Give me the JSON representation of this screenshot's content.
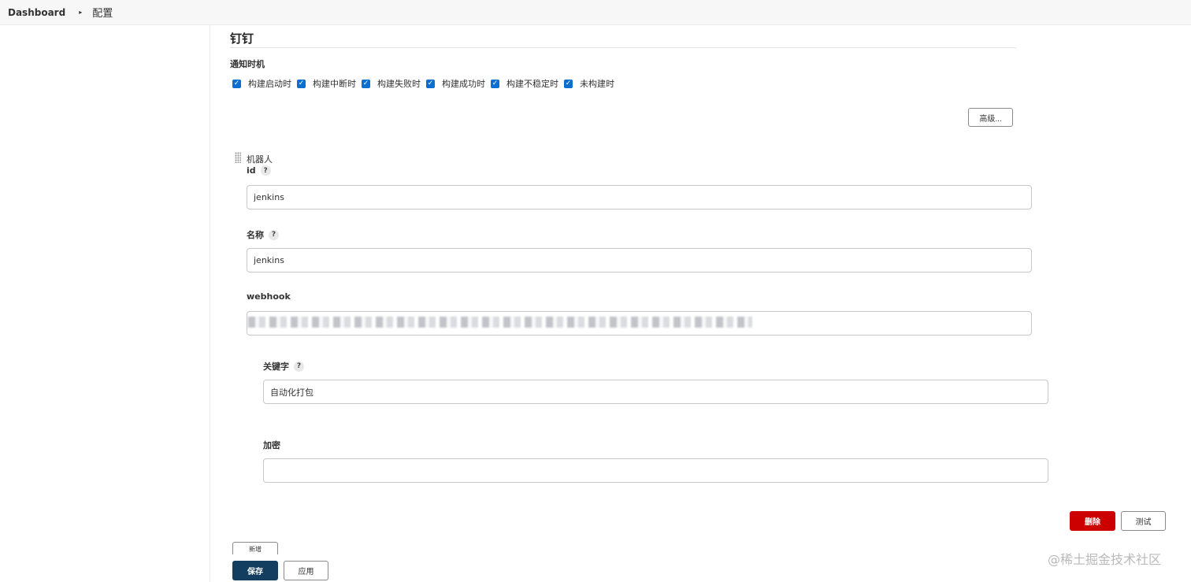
{
  "breadcrumb": {
    "root": "Dashboard",
    "separator": "▸",
    "current": "配置"
  },
  "section": {
    "title": "钉钉",
    "notify_label": "通知时机"
  },
  "notify_options": [
    {
      "label": "构建启动时",
      "checked": true
    },
    {
      "label": "构建中断时",
      "checked": true
    },
    {
      "label": "构建失败时",
      "checked": true
    },
    {
      "label": "构建成功时",
      "checked": true
    },
    {
      "label": "构建不稳定时",
      "checked": true
    },
    {
      "label": "未构建时",
      "checked": true
    }
  ],
  "advanced_button": "高级...",
  "robot": {
    "label": "机器人",
    "id_label": "id",
    "id_value": "jenkins",
    "name_label": "名称",
    "name_value": "jenkins",
    "webhook_label": "webhook",
    "webhook_value": "",
    "keyword_label": "关键字",
    "keyword_value": "自动化打包",
    "secret_label": "加密",
    "secret_value": ""
  },
  "help_glyph": "?",
  "buttons": {
    "delete": "删除",
    "test": "测试",
    "add": "新增",
    "save": "保存",
    "apply": "应用"
  },
  "watermark": "@稀土掘金技术社区",
  "colors": {
    "checkbox": "#0b6fd1",
    "delete": "#cc0000",
    "save": "#143e60"
  }
}
